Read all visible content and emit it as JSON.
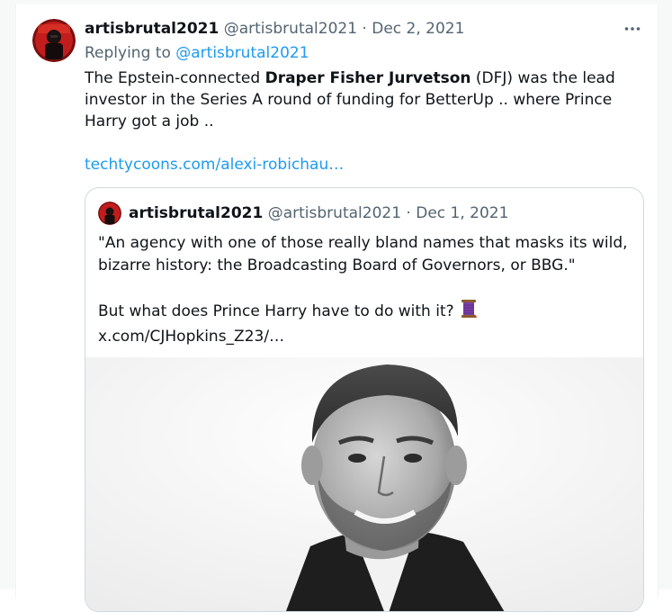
{
  "tweet": {
    "display_name": "artisbrutal2021",
    "handle": "@artisbrutal2021",
    "separator": "·",
    "date": "Dec 2, 2021",
    "more_icon": "more-horizontal-icon",
    "replying_prefix": "Replying to",
    "replying_to": "@artisbrutal2021",
    "text_before_bold": "The Epstein-connected",
    "text_bold": "Draper Fisher Jurvetson",
    "text_after_bold": "(DFJ) was the lead investor in the  Series A round of funding for BetterUp .. where Prince Harry got a job ..",
    "link_text": "techtycoons.com/alexi-robichau…"
  },
  "quoted": {
    "display_name": "artisbrutal2021",
    "handle": "@artisbrutal2021",
    "separator": "·",
    "date": "Dec 1, 2021",
    "text_para1": "\"An agency with one of those really bland names that masks its wild, bizarre history: the Broadcasting Board of Governors, or BBG.\"",
    "text_para2_before_icon": "But what does Prince Harry have to do with it?",
    "thread_icon": "spool-of-thread-icon",
    "text_para2_link": "x.com/CJHopkins_Z23/…",
    "media_icon": "photo-icon"
  },
  "colors": {
    "primary_text": "#0f1419",
    "secondary_text": "#536471",
    "link": "#1d9bf0",
    "border": "#cfd9de",
    "background": "#ffffff"
  }
}
